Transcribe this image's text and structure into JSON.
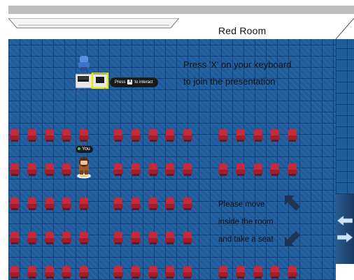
{
  "room": {
    "name": "Red Room"
  },
  "instructions": {
    "line1": "Press 'X' on your keyboard",
    "line2": "to join the presentation"
  },
  "interact_hint": {
    "prefix": "Press",
    "key": "X",
    "suffix": "to interact"
  },
  "player": {
    "label": "You",
    "status_color": "#36d36a"
  },
  "guidance": {
    "line1": "Please move",
    "line2": "inside the room",
    "line3": "and take a seat"
  },
  "colors": {
    "floor": "#1f5c9c",
    "seat": "#c62a3a",
    "highlight": "#e8e800"
  },
  "icons": [
    "arrow-up-left-icon",
    "arrow-down-left-icon",
    "door-arrow-left-icon",
    "door-arrow-right-icon"
  ]
}
